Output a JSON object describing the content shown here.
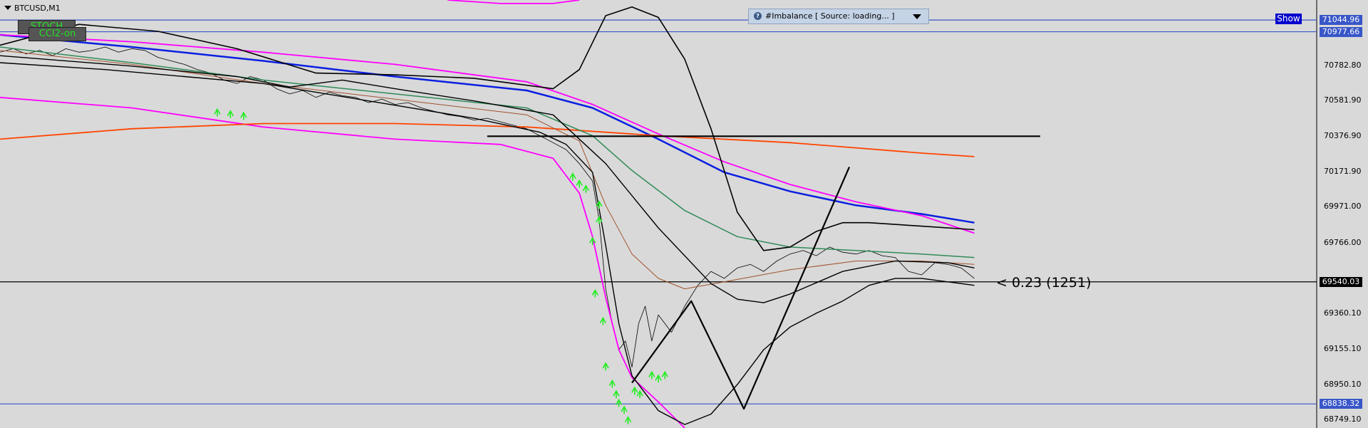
{
  "symbol": "BTCUSD,M1",
  "buttons": {
    "stoch": "STOCH",
    "cci": "CCI2-on",
    "show": "Show"
  },
  "imbalance_panel": {
    "info_icon": "info-icon",
    "title": "#Imbalance [ Source: loading... ]"
  },
  "bar_label": "< 0.23 (1251)",
  "colors": {
    "background": "#d9d9d9",
    "blue_ma": "#0a1fe0",
    "magenta": "#ff00ff",
    "orange": "#ff4500",
    "green_ma": "#2e8b57",
    "brown_ma": "#a0522d",
    "hline": "#3856c9",
    "arrows": "#22ee22"
  },
  "chart_data": {
    "type": "line",
    "symbol": "BTCUSD",
    "timeframe": "M1",
    "ylim": [
      68700,
      71160
    ],
    "y_ticks": [
      "70782.80",
      "70581.90",
      "70376.90",
      "70171.90",
      "69971.00",
      "69766.00",
      "69360.10",
      "69155.10",
      "68950.10",
      "68749.10"
    ],
    "price_tags": [
      {
        "label": "71044.96",
        "value": 71044.96,
        "style": "blue"
      },
      {
        "label": "70977.66",
        "value": 70977.66,
        "style": "blue"
      },
      {
        "label": "69540.03",
        "value": 69540.03,
        "style": "black"
      },
      {
        "label": "68838.32",
        "value": 68838.32,
        "style": "blue"
      }
    ],
    "horizontal_lines": [
      {
        "value": 71044.96,
        "color": "#3856c9"
      },
      {
        "value": 70977.66,
        "color": "#3856c9"
      },
      {
        "value": 69540.03,
        "color": "#000000"
      },
      {
        "value": 68838.32,
        "color": "#3856c9"
      }
    ],
    "x_range": [
      0,
      100
    ],
    "series": [
      {
        "role": "price",
        "color": "#000000",
        "width": 0.8,
        "points": [
          [
            0,
            70860
          ],
          [
            1,
            70880
          ],
          [
            2,
            70850
          ],
          [
            3,
            70870
          ],
          [
            4,
            70840
          ],
          [
            5,
            70880
          ],
          [
            6,
            70860
          ],
          [
            7,
            70870
          ],
          [
            8,
            70890
          ],
          [
            9,
            70860
          ],
          [
            10,
            70880
          ],
          [
            11,
            70870
          ],
          [
            12,
            70830
          ],
          [
            13,
            70810
          ],
          [
            14,
            70790
          ],
          [
            15,
            70760
          ],
          [
            16,
            70740
          ],
          [
            17,
            70700
          ],
          [
            18,
            70680
          ],
          [
            19,
            70720
          ],
          [
            20,
            70700
          ],
          [
            21,
            70650
          ],
          [
            22,
            70620
          ],
          [
            23,
            70640
          ],
          [
            24,
            70600
          ],
          [
            25,
            70630
          ],
          [
            26,
            70610
          ],
          [
            27,
            70600
          ],
          [
            28,
            70570
          ],
          [
            29,
            70590
          ],
          [
            30,
            70560
          ],
          [
            31,
            70570
          ],
          [
            32,
            70540
          ],
          [
            33,
            70520
          ],
          [
            34,
            70500
          ],
          [
            35,
            70490
          ],
          [
            36,
            70470
          ],
          [
            37,
            70480
          ],
          [
            38,
            70460
          ],
          [
            39,
            70440
          ],
          [
            40,
            70420
          ],
          [
            41,
            70380
          ],
          [
            42,
            70340
          ],
          [
            43,
            70300
          ],
          [
            44,
            70220
          ],
          [
            45,
            70120
          ],
          [
            45.5,
            69900
          ],
          [
            46,
            69500
          ],
          [
            46.5,
            69300
          ],
          [
            47,
            69150
          ],
          [
            47.5,
            69200
          ],
          [
            48,
            69050
          ],
          [
            48.5,
            69300
          ],
          [
            49,
            69400
          ],
          [
            49.5,
            69200
          ],
          [
            50,
            69350
          ],
          [
            51,
            69250
          ],
          [
            52,
            69400
          ],
          [
            53,
            69520
          ],
          [
            54,
            69600
          ],
          [
            55,
            69560
          ],
          [
            56,
            69620
          ],
          [
            57,
            69640
          ],
          [
            58,
            69600
          ],
          [
            59,
            69660
          ],
          [
            60,
            69700
          ],
          [
            61,
            69720
          ],
          [
            62,
            69690
          ],
          [
            63,
            69740
          ],
          [
            64,
            69710
          ],
          [
            65,
            69700
          ],
          [
            66,
            69720
          ],
          [
            67,
            69690
          ],
          [
            68,
            69680
          ],
          [
            69,
            69600
          ],
          [
            70,
            69580
          ],
          [
            71,
            69650
          ],
          [
            72,
            69640
          ],
          [
            73,
            69620
          ],
          [
            74,
            69560
          ]
        ]
      },
      {
        "role": "blue_ma",
        "color": "#0a1fe0",
        "width": 2.5,
        "points": [
          [
            0,
            70960
          ],
          [
            10,
            70890
          ],
          [
            20,
            70810
          ],
          [
            30,
            70720
          ],
          [
            40,
            70640
          ],
          [
            45,
            70540
          ],
          [
            50,
            70360
          ],
          [
            55,
            70170
          ],
          [
            60,
            70060
          ],
          [
            65,
            69980
          ],
          [
            70,
            69930
          ],
          [
            74,
            69880
          ]
        ]
      },
      {
        "role": "magenta_upper",
        "color": "#ff00ff",
        "width": 1.8,
        "points": [
          [
            0,
            70960
          ],
          [
            10,
            70920
          ],
          [
            20,
            70860
          ],
          [
            30,
            70790
          ],
          [
            40,
            70690
          ],
          [
            45,
            70560
          ],
          [
            50,
            70390
          ],
          [
            55,
            70230
          ],
          [
            60,
            70100
          ],
          [
            65,
            70000
          ],
          [
            70,
            69920
          ],
          [
            74,
            69820
          ]
        ]
      },
      {
        "role": "magenta_lower",
        "color": "#ff00ff",
        "width": 1.8,
        "points": [
          [
            0,
            70600
          ],
          [
            10,
            70540
          ],
          [
            20,
            70430
          ],
          [
            30,
            70360
          ],
          [
            38,
            70330
          ],
          [
            42,
            70250
          ],
          [
            44,
            70050
          ],
          [
            45,
            69800
          ],
          [
            46,
            69450
          ],
          [
            47,
            69150
          ],
          [
            48,
            68990
          ],
          [
            50,
            68850
          ],
          [
            52,
            68700
          ]
        ]
      },
      {
        "role": "magenta_top_arc",
        "color": "#ff00ff",
        "width": 1.8,
        "points": [
          [
            34,
            71160
          ],
          [
            38,
            71140
          ],
          [
            42,
            71140
          ],
          [
            44,
            71160
          ]
        ]
      },
      {
        "role": "orange",
        "color": "#ff4500",
        "width": 1.8,
        "points": [
          [
            0,
            70360
          ],
          [
            10,
            70420
          ],
          [
            20,
            70450
          ],
          [
            30,
            70450
          ],
          [
            40,
            70430
          ],
          [
            50,
            70380
          ],
          [
            60,
            70340
          ],
          [
            70,
            70280
          ],
          [
            74,
            70260
          ]
        ]
      },
      {
        "role": "green_ma",
        "color": "#2e8b57",
        "width": 1.5,
        "points": [
          [
            0,
            70890
          ],
          [
            10,
            70800
          ],
          [
            20,
            70700
          ],
          [
            30,
            70620
          ],
          [
            40,
            70540
          ],
          [
            45,
            70380
          ],
          [
            48,
            70180
          ],
          [
            52,
            69950
          ],
          [
            56,
            69800
          ],
          [
            60,
            69740
          ],
          [
            65,
            69720
          ],
          [
            70,
            69700
          ],
          [
            74,
            69680
          ]
        ]
      },
      {
        "role": "brown_ma",
        "color": "#a0522d",
        "width": 1.0,
        "points": [
          [
            0,
            70870
          ],
          [
            10,
            70790
          ],
          [
            20,
            70680
          ],
          [
            30,
            70590
          ],
          [
            40,
            70500
          ],
          [
            44,
            70350
          ],
          [
            46,
            69980
          ],
          [
            48,
            69700
          ],
          [
            50,
            69560
          ],
          [
            52,
            69500
          ],
          [
            55,
            69540
          ],
          [
            60,
            69610
          ],
          [
            65,
            69660
          ],
          [
            70,
            69660
          ],
          [
            74,
            69640
          ]
        ]
      },
      {
        "role": "envelope_upper",
        "color": "#000000",
        "width": 1.6,
        "points": [
          [
            0,
            70900
          ],
          [
            6,
            71020
          ],
          [
            12,
            70980
          ],
          [
            18,
            70880
          ],
          [
            24,
            70740
          ],
          [
            30,
            70730
          ],
          [
            36,
            70710
          ],
          [
            42,
            70650
          ],
          [
            44,
            70760
          ],
          [
            46,
            71070
          ],
          [
            48,
            71120
          ],
          [
            50,
            71060
          ],
          [
            52,
            70820
          ],
          [
            54,
            70420
          ],
          [
            56,
            69940
          ],
          [
            58,
            69720
          ],
          [
            60,
            69740
          ],
          [
            62,
            69830
          ],
          [
            64,
            69880
          ],
          [
            66,
            69880
          ],
          [
            70,
            69860
          ],
          [
            74,
            69840
          ]
        ]
      },
      {
        "role": "envelope_lower",
        "color": "#000000",
        "width": 1.4,
        "points": [
          [
            0,
            70800
          ],
          [
            8,
            70760
          ],
          [
            14,
            70720
          ],
          [
            20,
            70680
          ],
          [
            28,
            70580
          ],
          [
            36,
            70480
          ],
          [
            41,
            70400
          ],
          [
            43,
            70330
          ],
          [
            45,
            70170
          ],
          [
            46,
            69750
          ],
          [
            47,
            69300
          ],
          [
            48,
            69000
          ],
          [
            50,
            68800
          ],
          [
            52,
            68720
          ],
          [
            54,
            68780
          ],
          [
            56,
            68950
          ],
          [
            58,
            69150
          ],
          [
            60,
            69280
          ],
          [
            62,
            69360
          ],
          [
            64,
            69430
          ],
          [
            66,
            69520
          ],
          [
            68,
            69560
          ],
          [
            70,
            69560
          ],
          [
            72,
            69540
          ],
          [
            74,
            69520
          ]
        ]
      },
      {
        "role": "midline",
        "color": "#000000",
        "width": 1.4,
        "points": [
          [
            0,
            70840
          ],
          [
            10,
            70780
          ],
          [
            18,
            70720
          ],
          [
            22,
            70660
          ],
          [
            26,
            70700
          ],
          [
            30,
            70650
          ],
          [
            36,
            70580
          ],
          [
            42,
            70500
          ],
          [
            46,
            70220
          ],
          [
            50,
            69850
          ],
          [
            54,
            69530
          ],
          [
            56,
            69440
          ],
          [
            58,
            69420
          ],
          [
            60,
            69470
          ],
          [
            64,
            69600
          ],
          [
            68,
            69660
          ],
          [
            72,
            69650
          ],
          [
            74,
            69620
          ]
        ]
      },
      {
        "role": "zigzag",
        "color": "#000000",
        "width": 2.2,
        "points": [
          [
            48,
            68960
          ],
          [
            52.5,
            69430
          ],
          [
            56.5,
            68810
          ],
          [
            64.5,
            70200
          ]
        ]
      },
      {
        "role": "level_370376",
        "color": "#000000",
        "width": 2.2,
        "points": [
          [
            37,
            70376.9
          ],
          [
            79,
            70376.9
          ]
        ]
      }
    ],
    "up_arrows": [
      [
        16.5,
        70520
      ],
      [
        17.5,
        70510
      ],
      [
        18.5,
        70500
      ],
      [
        43.5,
        70150
      ],
      [
        44,
        70110
      ],
      [
        44.5,
        70080
      ],
      [
        45.5,
        69990
      ],
      [
        45.5,
        69900
      ],
      [
        45,
        69780
      ],
      [
        45.2,
        69480
      ],
      [
        45.8,
        69320
      ],
      [
        46,
        69060
      ],
      [
        46.5,
        68960
      ],
      [
        46.8,
        68900
      ],
      [
        47,
        68850
      ],
      [
        47.4,
        68810
      ],
      [
        47.7,
        68750
      ],
      [
        48.2,
        68920
      ],
      [
        48.6,
        68900
      ],
      [
        49.5,
        69010
      ],
      [
        50,
        68990
      ],
      [
        50.5,
        69010
      ]
    ]
  }
}
